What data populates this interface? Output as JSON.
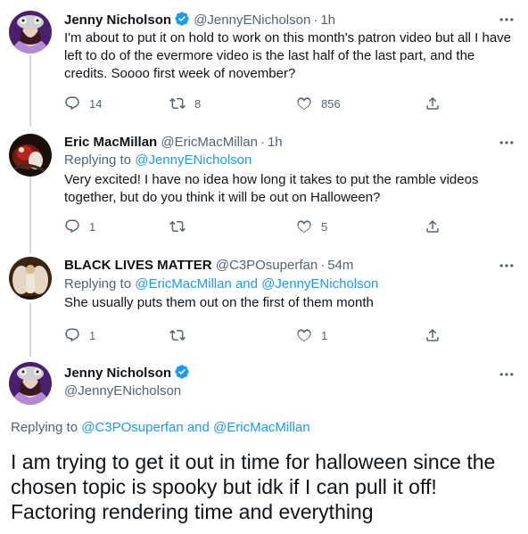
{
  "tweets": [
    {
      "author_name": "Jenny Nicholson",
      "handle": "@JennyENicholson",
      "time": "1h",
      "verified": true,
      "text": "I'm about to put it on hold to work on this month's patron video but all I have left to do of the evermore video is the last half of the last part, and the credits. Soooo first week of november?",
      "replies": "14",
      "retweets": "8",
      "likes": "856",
      "avatar_icon": "cat-hat-avatar"
    },
    {
      "author_name": "Eric MacMillan",
      "handle": "@EricMacMillan",
      "time": "1h",
      "replying_prefix": "Replying to",
      "replying_to": "@JennyENicholson",
      "text": "Very excited! I have no idea how long it takes to put the ramble videos together, but do you think it will be out on Halloween?",
      "replies": "1",
      "retweets": "",
      "likes": "5",
      "avatar_icon": "red-figure-avatar"
    },
    {
      "author_name": "BLACK LIVES MATTER",
      "handle": "@C3POsuperfan",
      "time": "54m",
      "replying_prefix": "Replying to",
      "replying_to": "@EricMacMillan and @JennyENicholson",
      "text": "She usually puts them out on the first of them month",
      "replies": "1",
      "retweets": "",
      "likes": "1",
      "avatar_icon": "figure-with-wings-avatar"
    }
  ],
  "main_tweet": {
    "author_name": "Jenny Nicholson",
    "handle": "@JennyENicholson",
    "verified": true,
    "replying_prefix": "Replying to",
    "replying_to": "@C3POsuperfan and @EricMacMillan",
    "text": "I am trying to get it out in time for halloween since the chosen topic is spooky but idk if I can pull it off! Factoring rendering time and everything",
    "avatar_icon": "cat-hat-avatar"
  },
  "colors": {
    "accent": "#1d9bf0",
    "secondary_text": "#536471",
    "primary_text": "#0f1419",
    "thread_line": "#cfd9de"
  }
}
